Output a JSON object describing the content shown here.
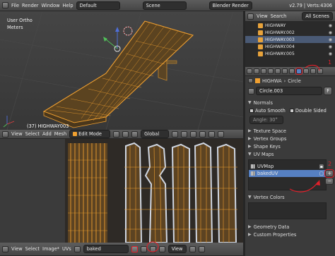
{
  "info_header": {
    "menus": [
      "File",
      "Render",
      "Window",
      "Help"
    ],
    "screen_layout": "Default",
    "scene": "Scene",
    "render_engine": "Blender Render",
    "stats": "v2.79 | Verts:4306"
  },
  "viewport3d": {
    "view_name": "User Ortho",
    "units": "Meters",
    "object_label": "(37) HIGHWAY003"
  },
  "view3d_header": {
    "menus": [
      "View",
      "Select",
      "Add",
      "Mesh"
    ],
    "mode": "Edit Mode",
    "orientation": "Global"
  },
  "outliner": {
    "menus": [
      "View",
      "Search"
    ],
    "filter": "All Scenes",
    "items": [
      "HIGHWAY",
      "HIGHWAY.002",
      "HIGHWAY.003",
      "HIGHWAY.004",
      "HIGHWAY.005"
    ]
  },
  "properties": {
    "breadcrumb_object": "HIGHWA",
    "breadcrumb_mesh": "Circle",
    "datablock_name": "Circle.003",
    "panels": {
      "normals": "Normals",
      "auto_smooth": "Auto Smooth",
      "double_sided": "Double Sided",
      "angle": "Angle: 30°",
      "texture_space": "Texture Space",
      "vertex_groups": "Vertex Groups",
      "shape_keys": "Shape Keys",
      "uv_maps": "UV Maps",
      "vertex_colors": "Vertex Colors",
      "geometry_data": "Geometry Data",
      "custom_properties": "Custom Properties"
    },
    "uv_maps": [
      "UVMap",
      "bakedUV"
    ],
    "selected_uv_map": "bakedUV",
    "annotations": [
      "1",
      "2"
    ]
  },
  "uv_header": {
    "menus": [
      "View",
      "Select",
      "Image*",
      "UVs"
    ],
    "image_name": "baked",
    "view_menu": "View"
  },
  "colors": {
    "accent": "#5680c2",
    "selection_orange": "#f0a030",
    "annotation_red": "#e0202a"
  }
}
